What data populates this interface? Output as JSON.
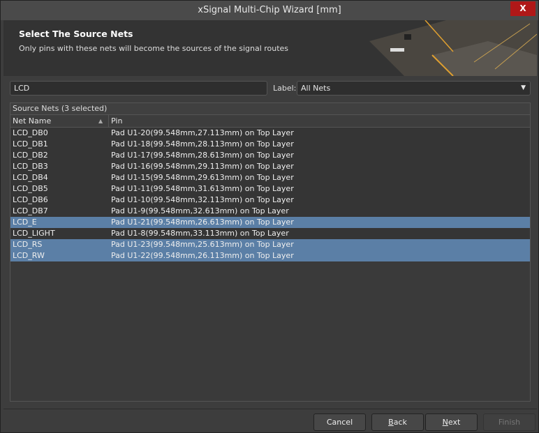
{
  "window": {
    "title": "xSignal Multi-Chip Wizard [mm]",
    "close_label": "X"
  },
  "banner": {
    "title": "Select The Source Nets",
    "subtitle": "Only pins with these nets will become the sources of the signal routes"
  },
  "filter": {
    "search_value": "LCD",
    "label_caption": "Label:",
    "label_value": "All Nets"
  },
  "table": {
    "group_title": "Source Nets (3 selected)",
    "columns": [
      "Net Name",
      "Pin"
    ],
    "rows": [
      {
        "net": "LCD_DB0",
        "pin": "Pad U1-20(99.548mm,27.113mm) on Top Layer",
        "selected": false
      },
      {
        "net": "LCD_DB1",
        "pin": "Pad U1-18(99.548mm,28.113mm) on Top Layer",
        "selected": false
      },
      {
        "net": "LCD_DB2",
        "pin": "Pad U1-17(99.548mm,28.613mm) on Top Layer",
        "selected": false
      },
      {
        "net": "LCD_DB3",
        "pin": "Pad U1-16(99.548mm,29.113mm) on Top Layer",
        "selected": false
      },
      {
        "net": "LCD_DB4",
        "pin": "Pad U1-15(99.548mm,29.613mm) on Top Layer",
        "selected": false
      },
      {
        "net": "LCD_DB5",
        "pin": "Pad U1-11(99.548mm,31.613mm) on Top Layer",
        "selected": false
      },
      {
        "net": "LCD_DB6",
        "pin": "Pad U1-10(99.548mm,32.113mm) on Top Layer",
        "selected": false
      },
      {
        "net": "LCD_DB7",
        "pin": "Pad U1-9(99.548mm,32.613mm) on Top Layer",
        "selected": false
      },
      {
        "net": "LCD_E",
        "pin": "Pad U1-21(99.548mm,26.613mm) on Top Layer",
        "selected": true
      },
      {
        "net": "LCD_LIGHT",
        "pin": "Pad U1-8(99.548mm,33.113mm) on Top Layer",
        "selected": false
      },
      {
        "net": "LCD_RS",
        "pin": "Pad U1-23(99.548mm,25.613mm) on Top Layer",
        "selected": true
      },
      {
        "net": "LCD_RW",
        "pin": "Pad U1-22(99.548mm,26.113mm) on Top Layer",
        "selected": true
      }
    ]
  },
  "buttons": {
    "cancel": "Cancel",
    "back_u": "B",
    "back_rest": "ack",
    "next_u": "N",
    "next_rest": "ext",
    "finish": "Finish"
  }
}
